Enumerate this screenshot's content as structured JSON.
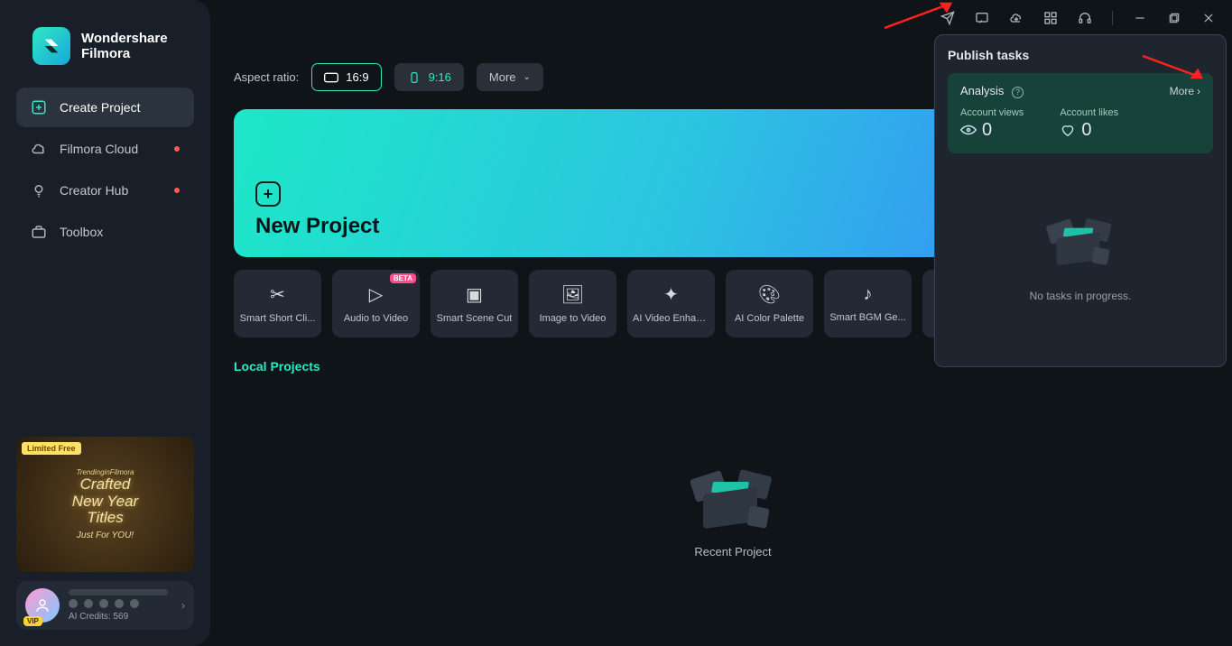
{
  "brand": {
    "line1": "Wondershare",
    "line2": "Filmora"
  },
  "nav": {
    "items": [
      {
        "label": "Create Project",
        "icon": "plus-box-icon",
        "active": true
      },
      {
        "label": "Filmora Cloud",
        "icon": "cloud-icon",
        "dot": true
      },
      {
        "label": "Creator Hub",
        "icon": "bulb-icon",
        "dot": true
      },
      {
        "label": "Toolbox",
        "icon": "toolbox-icon"
      }
    ]
  },
  "promo": {
    "tag": "Limited Free",
    "line1": "Crafted",
    "line2": "New Year",
    "line3": "Titles",
    "sub": "Just For YOU!",
    "tease": "TrendinginFilmora"
  },
  "user": {
    "credits_label": "AI Credits: 569",
    "vip": "VIP"
  },
  "aspect": {
    "label": "Aspect ratio:",
    "r169": "16:9",
    "r916": "9:16",
    "more": "More"
  },
  "new_project": {
    "title": "New Project"
  },
  "tools": [
    {
      "label": "Smart Short Cli...",
      "icon": "scissors-icon"
    },
    {
      "label": "Audio to Video",
      "icon": "audio-video-icon",
      "badge": "BETA"
    },
    {
      "label": "Smart Scene Cut",
      "icon": "scene-cut-icon"
    },
    {
      "label": "Image to Video",
      "icon": "image-video-icon"
    },
    {
      "label": "AI Video Enhan...",
      "icon": "enhance-icon"
    },
    {
      "label": "AI Color Palette",
      "icon": "palette-icon"
    },
    {
      "label": "Smart BGM Ge...",
      "icon": "bgm-icon"
    }
  ],
  "local_projects": {
    "title": "Local Projects"
  },
  "recent": {
    "label": "Recent Project"
  },
  "publish": {
    "title": "Publish tasks",
    "analysis": "Analysis",
    "more": "More",
    "views_label": "Account views",
    "views_value": "0",
    "likes_label": "Account likes",
    "likes_value": "0",
    "empty": "No tasks in progress."
  }
}
